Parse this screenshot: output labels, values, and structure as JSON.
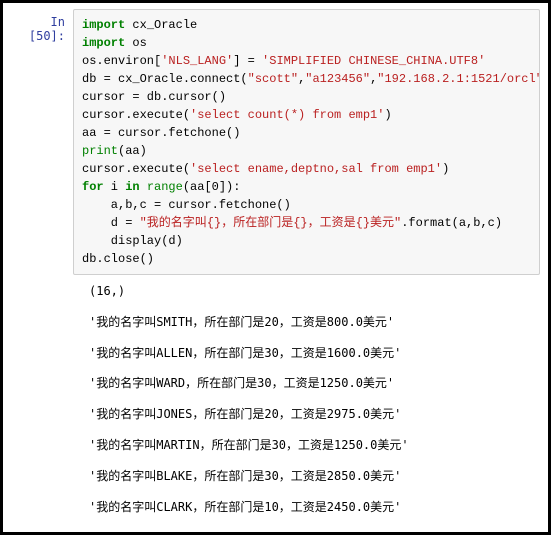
{
  "prompt": "In [50]:",
  "code": {
    "l1_kw1": "import",
    "l1_mod": " cx_Oracle",
    "l2_kw1": "import",
    "l2_mod": " os",
    "l3_a": "os.environ[",
    "l3_s1": "'NLS_LANG'",
    "l3_b": "] = ",
    "l3_s2": "'SIMPLIFIED CHINESE_CHINA.UTF8'",
    "l4": "",
    "l5_a": "db = cx_Oracle.connect(",
    "l5_s1": "\"scott\"",
    "l5_b": ",",
    "l5_s2": "\"a123456\"",
    "l5_c": ",",
    "l5_s3": "\"192.168.2.1:1521/orcl\"",
    "l5_d": ")",
    "l6": "cursor = db.cursor()",
    "l7": "",
    "l8_a": "cursor.execute(",
    "l8_s": "'select count(*) from emp1'",
    "l8_b": ")",
    "l9": "aa = cursor.fetchone()",
    "l10_fn": "print",
    "l10_b": "(aa)",
    "l11_a": "cursor.execute(",
    "l11_s": "'select ename,deptno,sal from emp1'",
    "l11_b": ")",
    "l12_kw1": "for",
    "l12_a": " i ",
    "l12_kw2": "in",
    "l12_b": " ",
    "l12_fn": "range",
    "l12_c": "(aa[0]):",
    "l13": "    a,b,c = cursor.fetchone()",
    "l14_a": "    d = ",
    "l14_s": "\"我的名字叫{}，所在部门是{}，工资是{}美元\"",
    "l14_b": ".format(a,b,c)",
    "l15": "    display(d)",
    "l16": "db.close()"
  },
  "output": {
    "o0": "(16,)",
    "o1": "'我的名字叫SMITH，所在部门是20，工资是800.0美元'",
    "o2": "'我的名字叫ALLEN，所在部门是30，工资是1600.0美元'",
    "o3": "'我的名字叫WARD，所在部门是30，工资是1250.0美元'",
    "o4": "'我的名字叫JONES，所在部门是20，工资是2975.0美元'",
    "o5": "'我的名字叫MARTIN，所在部门是30，工资是1250.0美元'",
    "o6": "'我的名字叫BLAKE，所在部门是30，工资是2850.0美元'",
    "o7": "'我的名字叫CLARK，所在部门是10，工资是2450.0美元'"
  }
}
